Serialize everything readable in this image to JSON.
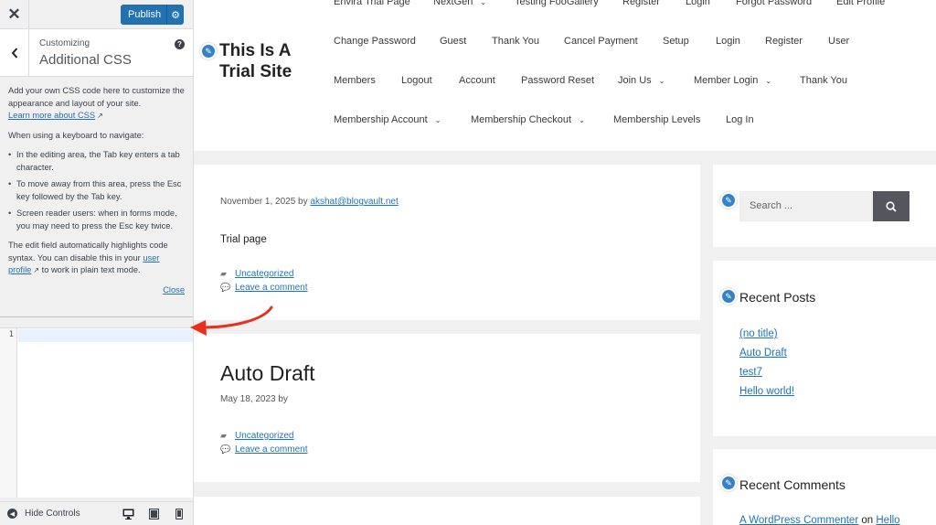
{
  "customizer": {
    "close_glyph": "✕",
    "publish_label": "Publish",
    "back_glyph": "‹",
    "customizing_label": "Customizing",
    "section_title": "Additional CSS",
    "help_glyph": "?",
    "intro": "Add your own CSS code here to customize the appearance and layout of your site.",
    "learn_more": "Learn more about CSS",
    "keyboard_heading": "When using a keyboard to navigate:",
    "bullets": [
      "In the editing area, the Tab key enters a tab character.",
      "To move away from this area, press the Esc key followed by the Tab key.",
      "Screen reader users: when in forms mode, you may need to press the Esc key twice."
    ],
    "highlight_pre": "The edit field automatically highlights code syntax. You can disable this in your",
    "user_profile": "user profile",
    "highlight_post": "to work in plain text mode.",
    "close_label": "Close",
    "line_number": "1",
    "hide_controls": "Hide Controls"
  },
  "site": {
    "title": "This Is A Trial Site",
    "nav": {
      "row0": [
        "Envira Trial Page",
        "NextGen",
        "Testing FooGallery",
        "Register",
        "Login",
        "Forgot Password",
        "Edit Profile"
      ],
      "row1": [
        "Change Password",
        "Guest",
        "Thank You",
        "Cancel Payment",
        "Setup",
        "Login",
        "Register",
        "User"
      ],
      "row2": [
        "Members",
        "Logout",
        "Account",
        "Password Reset",
        "Join Us",
        "Member Login",
        "Thank You"
      ],
      "row3": [
        "Membership Account",
        "Membership Checkout",
        "Membership Levels",
        "Log In"
      ]
    },
    "post1": {
      "date_prefix": "November 1, 2025 by",
      "author": "akshat@blogvault.net",
      "body": "Trial page",
      "category": "Uncategorized",
      "comment": "Leave a comment"
    },
    "post2": {
      "title": "Auto Draft",
      "date": "May 18, 2023 by",
      "category": "Uncategorized",
      "comment": "Leave a comment"
    },
    "search_placeholder": "Search ...",
    "recent_posts_title": "Recent Posts",
    "recent_posts": [
      "(no title)",
      "Auto Draft",
      "test7",
      "Hello world!"
    ],
    "recent_comments_title": "Recent Comments",
    "comment_author": "A WordPress Commenter",
    "comment_on": "on",
    "comment_post": "Hello"
  },
  "colors": {
    "accent": "#2271b1",
    "link": "#1e72bd",
    "arrow": "#e8301c"
  }
}
